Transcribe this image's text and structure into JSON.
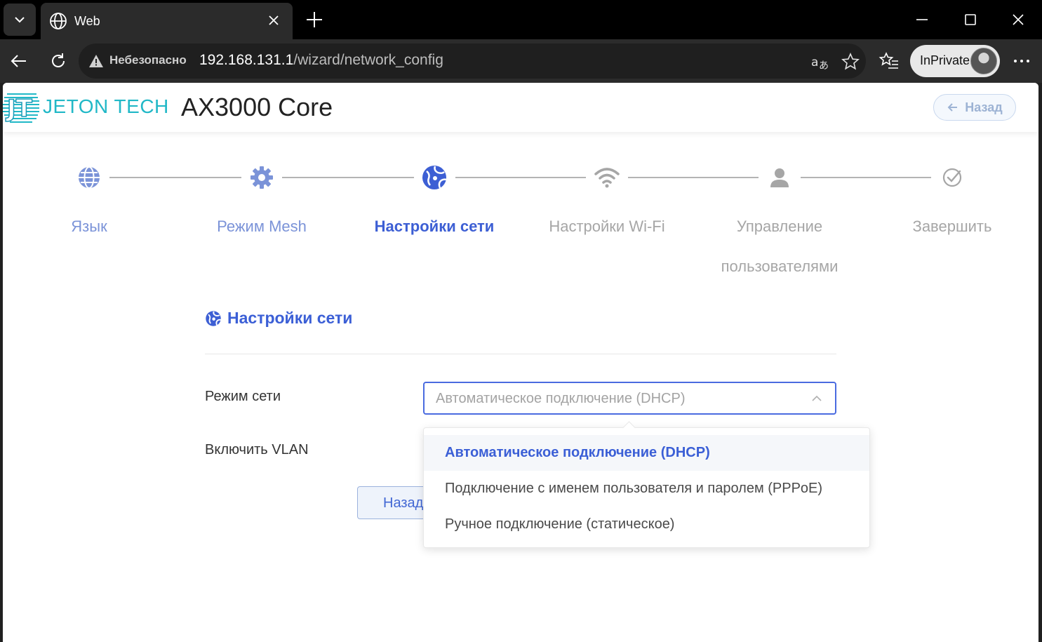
{
  "browser": {
    "tab_title": "Web",
    "security_label": "Небезопасно",
    "url_host": "192.168.131.1",
    "url_path": "/wizard/network_config",
    "inprivate_label": "InPrivate"
  },
  "header": {
    "brand": "JETON TECH",
    "product": "AX3000 Core",
    "back_button": "Назад"
  },
  "steps": [
    {
      "label": "Язык",
      "state": "done",
      "icon": "globe-icon"
    },
    {
      "label": "Режим Mesh",
      "state": "done",
      "icon": "gear-icon"
    },
    {
      "label": "Настройки сети",
      "state": "active",
      "icon": "network-globe-icon"
    },
    {
      "label": "Настройки Wi-Fi",
      "state": "pending",
      "icon": "wifi-icon"
    },
    {
      "label": "Управление пользователями",
      "state": "pending",
      "icon": "user-icon"
    },
    {
      "label": "Завершить",
      "state": "pending",
      "icon": "check-circle-icon"
    }
  ],
  "form": {
    "section_title": "Настройки сети",
    "network_mode_label": "Режим сети",
    "network_mode_value": "Автоматическое подключение (DHCP)",
    "vlan_label": "Включить VLAN",
    "back_button": "Назад"
  },
  "dropdown": {
    "options": [
      "Автоматическое подключение (DHCP)",
      "Подключение с именем пользователя и паролем (PPPoE)",
      "Ручное подключение (статическое)"
    ],
    "selected_index": 0
  },
  "colors": {
    "accent": "#3d5fd4",
    "step_done": "#7b93d8",
    "step_pending": "#a6a6a6",
    "brand": "#21b8c7"
  }
}
